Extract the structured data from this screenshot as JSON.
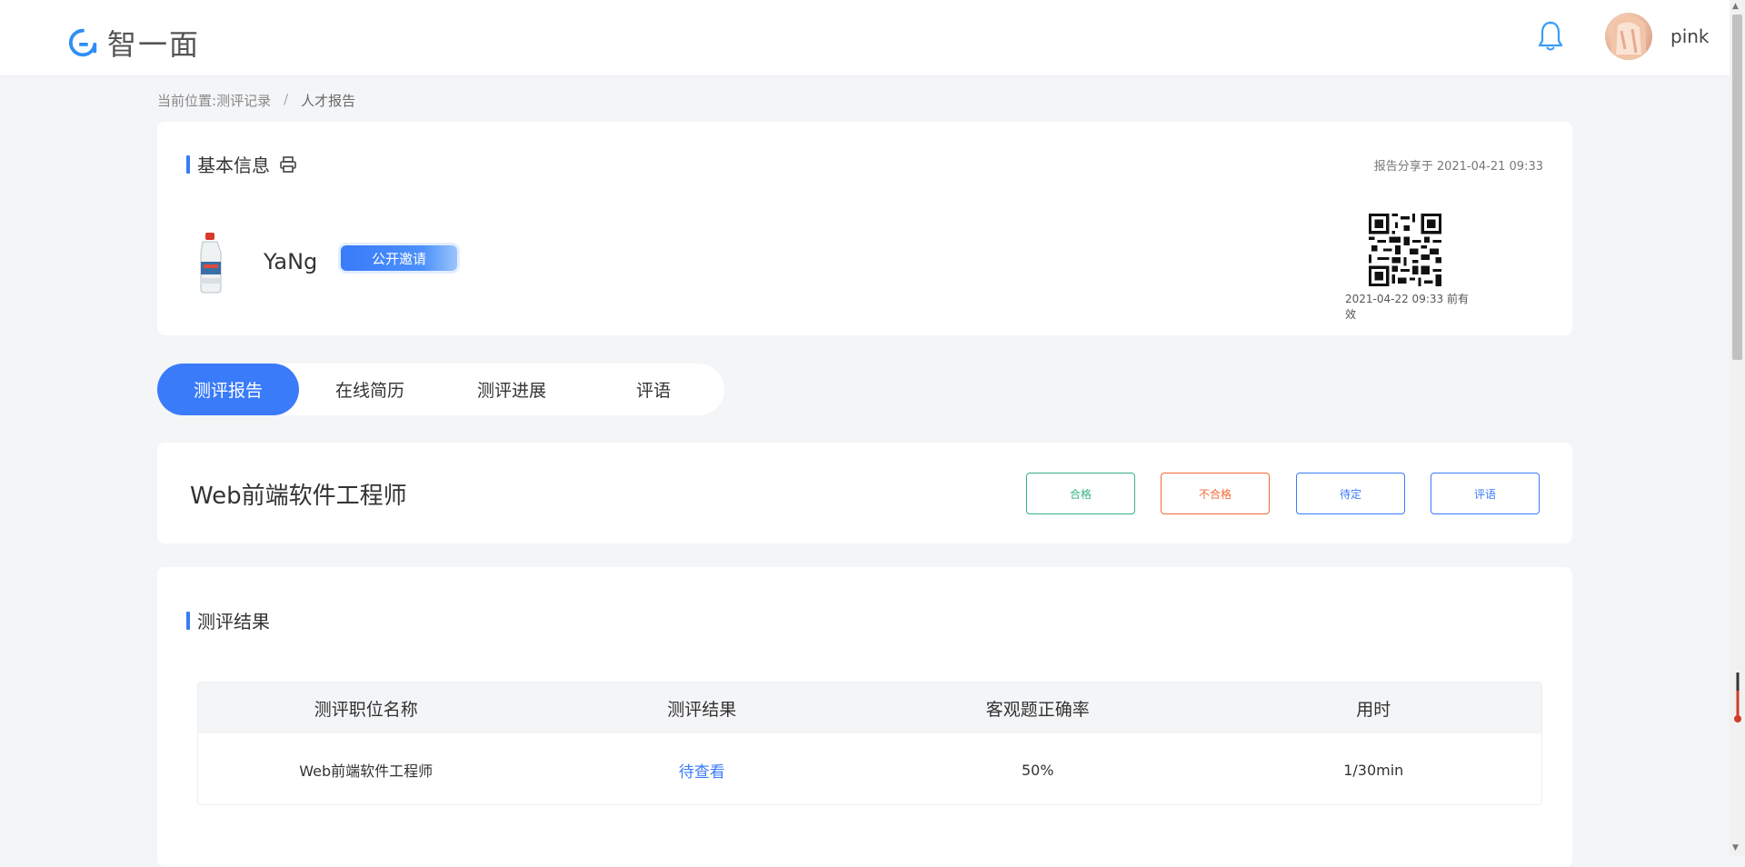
{
  "header": {
    "logo_text": "智一面",
    "username": "pink"
  },
  "breadcrumb": {
    "prefix": "当前位置:",
    "items": [
      "测评记录",
      "人才报告"
    ],
    "separator": "/"
  },
  "basic_info": {
    "title": "基本信息",
    "share_time": "报告分享于 2021-04-21 09:33",
    "name": "YaNg",
    "badge": "公开邀请",
    "qr_valid": "2021-04-22 09:33 前有效"
  },
  "tabs": [
    {
      "label": "测评报告",
      "active": true
    },
    {
      "label": "在线简历",
      "active": false
    },
    {
      "label": "测评进展",
      "active": false
    },
    {
      "label": "评语",
      "active": false
    }
  ],
  "position": {
    "title": "Web前端软件工程师",
    "buttons": {
      "pass": "合格",
      "fail": "不合格",
      "pending": "待定",
      "comment": "评语"
    }
  },
  "result": {
    "title": "测评结果",
    "columns": [
      "测评职位名称",
      "测评结果",
      "客观题正确率",
      "用时"
    ],
    "rows": [
      [
        "Web前端软件工程师",
        "待查看",
        "50%",
        "1/30min"
      ]
    ]
  },
  "colors": {
    "primary": "#3a7bfa",
    "pass": "#35b582",
    "fail": "#f26a3b",
    "background": "#f4f5f7"
  }
}
